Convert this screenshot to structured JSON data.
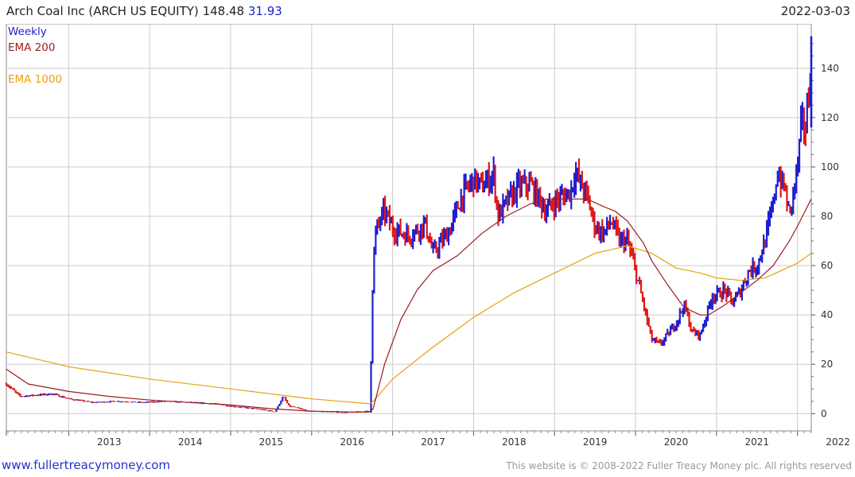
{
  "header": {
    "title": "Arch Coal Inc (ARCH US EQUITY)",
    "last_price": "148.48",
    "change": "31.93",
    "date": "2022-03-03"
  },
  "footer": {
    "site_link": "www.fullertreacymoney.com",
    "copyright": "This website is © 2008-2022 Fuller Treacy Money plc. All rights reserved"
  },
  "colors": {
    "up": "#1f1fd0",
    "down": "#e01818",
    "ema200": "#9b1c1c",
    "ema1000": "#e8a10c",
    "grid": "#cccccc"
  },
  "chart_data": {
    "type": "line",
    "subtype": "weekly candlestick with moving averages",
    "legend": [
      "Weekly",
      "EMA 200",
      "EMA 1000"
    ],
    "legend_position": "top-left",
    "x_axis": {
      "range": [
        2012.23,
        2022.17
      ],
      "tick_labels": [
        "2013",
        "2014",
        "2015",
        "2016",
        "2017",
        "2018",
        "2019",
        "2020",
        "2021",
        "2022"
      ]
    },
    "y_axis": {
      "side": "right",
      "range": [
        -7,
        158
      ],
      "ticks": [
        0,
        20,
        40,
        60,
        80,
        100,
        120,
        140
      ]
    },
    "grid": true,
    "series": [
      {
        "name": "Weekly",
        "x": [
          2012.23,
          2012.4,
          2012.6,
          2012.8,
          2013.0,
          2013.3,
          2013.6,
          2013.9,
          2014.2,
          2014.5,
          2014.8,
          2015.0,
          2015.3,
          2015.55,
          2015.65,
          2015.72,
          2015.8,
          2015.95,
          2016.2,
          2016.5,
          2016.72,
          2016.76,
          2016.8,
          2016.9,
          2017.0,
          2017.2,
          2017.4,
          2017.5,
          2017.7,
          2017.85,
          2018.0,
          2018.1,
          2018.25,
          2018.3,
          2018.4,
          2018.55,
          2018.7,
          2018.9,
          2019.0,
          2019.2,
          2019.25,
          2019.4,
          2019.5,
          2019.6,
          2019.7,
          2019.8,
          2019.9,
          2020.0,
          2020.1,
          2020.2,
          2020.3,
          2020.4,
          2020.5,
          2020.6,
          2020.7,
          2020.8,
          2020.95,
          2021.0,
          2021.1,
          2021.2,
          2021.3,
          2021.4,
          2021.5,
          2021.6,
          2021.7,
          2021.75,
          2021.85,
          2021.9,
          2022.0,
          2022.05,
          2022.1,
          2022.14,
          2022.17
        ],
        "y": [
          12,
          7,
          7.5,
          8,
          6,
          4.5,
          5,
          4.5,
          5,
          4.5,
          4,
          3,
          2,
          0.8,
          7,
          3,
          2.5,
          1,
          0.8,
          0.5,
          1,
          62,
          75,
          82,
          75,
          72,
          77,
          65,
          74,
          88,
          95,
          92,
          97,
          80,
          85,
          92,
          93,
          82,
          86,
          90,
          98,
          88,
          76,
          73,
          78,
          70,
          70,
          58,
          44,
          30,
          28,
          32,
          37,
          44,
          33,
          32,
          48,
          48,
          50,
          45,
          50,
          58,
          60,
          70,
          85,
          98,
          90,
          80,
          100,
          118,
          116,
          130,
          148.48
        ]
      },
      {
        "name": "EMA 200",
        "x": [
          2012.23,
          2012.5,
          2013.0,
          2013.5,
          2014.0,
          2014.5,
          2015.0,
          2015.5,
          2016.0,
          2016.5,
          2016.72,
          2016.76,
          2016.9,
          2017.1,
          2017.3,
          2017.5,
          2017.8,
          2018.1,
          2018.4,
          2018.7,
          2018.9,
          2019.2,
          2019.4,
          2019.6,
          2019.75,
          2019.9,
          2020.1,
          2020.2,
          2020.4,
          2020.6,
          2020.8,
          2020.9,
          2021.1,
          2021.3,
          2021.5,
          2021.7,
          2021.9,
          2022.0,
          2022.17
        ],
        "y": [
          18,
          12,
          9,
          7,
          5.5,
          4.5,
          3.5,
          2,
          1,
          0.6,
          0.7,
          2,
          20,
          38,
          50,
          58,
          64,
          73,
          80,
          85,
          87,
          87,
          87,
          84,
          82,
          78,
          69,
          62,
          52,
          43,
          40,
          40,
          44,
          49,
          54,
          60,
          70,
          76,
          87
        ]
      },
      {
        "name": "EMA 1000",
        "x": [
          2012.23,
          2013.0,
          2014.0,
          2015.0,
          2016.0,
          2016.72,
          2016.76,
          2017.0,
          2017.5,
          2018.0,
          2018.5,
          2019.0,
          2019.5,
          2019.9,
          2020.2,
          2020.5,
          2020.8,
          2021.0,
          2021.3,
          2021.6,
          2021.8,
          2022.0,
          2022.17
        ],
        "y": [
          25,
          19,
          14,
          10,
          6,
          4,
          5,
          14,
          27,
          39,
          49,
          57,
          65,
          68,
          65,
          59,
          57,
          55,
          54,
          55,
          58,
          61,
          65
        ]
      }
    ]
  }
}
